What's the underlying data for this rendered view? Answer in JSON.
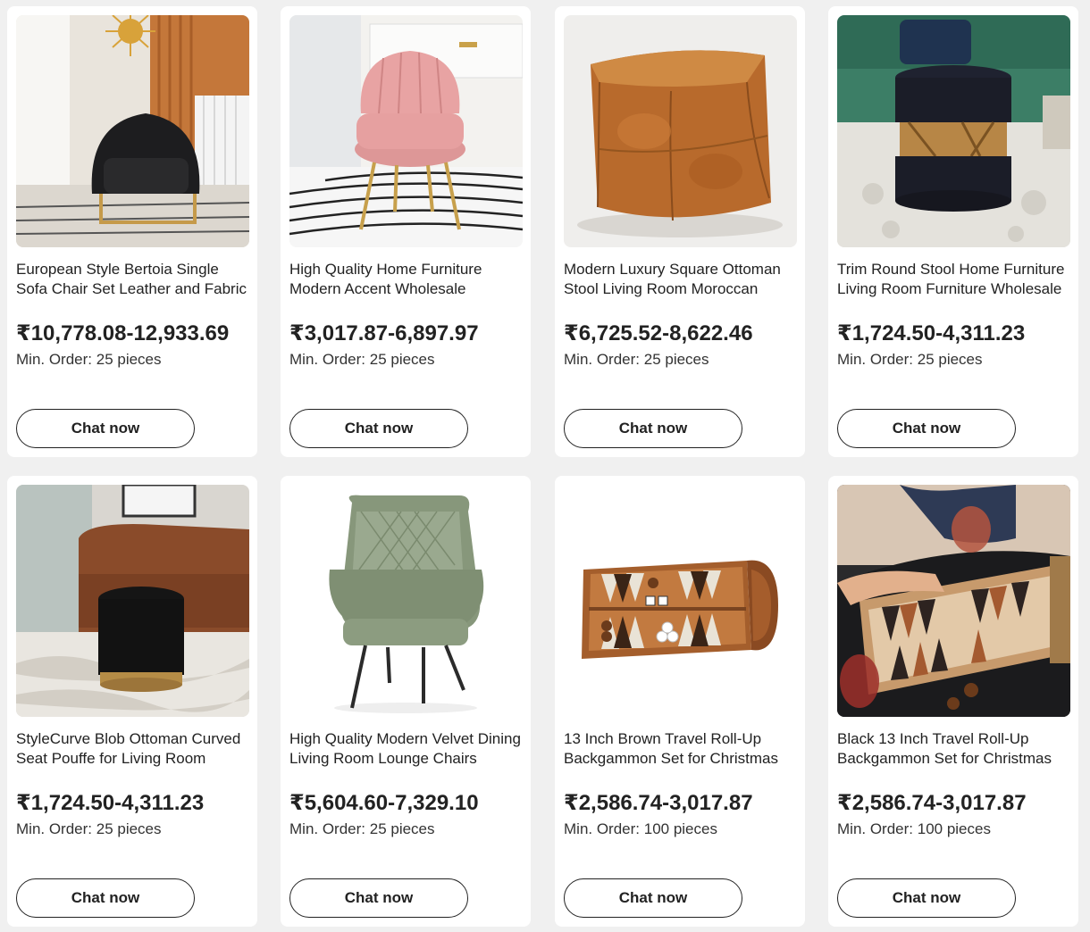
{
  "chat_label": "Chat now",
  "products": [
    {
      "title": "European Style Bertoia Single Sofa Chair Set Leather and Fabric",
      "price": "₹10,778.08-12,933.69",
      "moq": "Min. Order: 25 pieces",
      "image": "black-velvet-armchair"
    },
    {
      "title": "High Quality Home Furniture Modern Accent Wholesale",
      "price": "₹3,017.87-6,897.97",
      "moq": "Min. Order: 25 pieces",
      "image": "pink-velvet-chair"
    },
    {
      "title": "Modern Luxury Square Ottoman Stool Living Room Moroccan",
      "price": "₹6,725.52-8,622.46",
      "moq": "Min. Order: 25 pieces",
      "image": "leather-square-pouf"
    },
    {
      "title": "Trim Round Stool Home Furniture Living Room Furniture Wholesale",
      "price": "₹1,724.50-4,311.23",
      "moq": "Min. Order: 25 pieces",
      "image": "black-round-stool"
    },
    {
      "title": "StyleCurve Blob Ottoman Curved Seat Pouffe for Living Room",
      "price": "₹1,724.50-4,311.23",
      "moq": "Min. Order: 25 pieces",
      "image": "black-velvet-pouffe"
    },
    {
      "title": "High Quality Modern Velvet Dining Living Room Lounge Chairs",
      "price": "₹5,604.60-7,329.10",
      "moq": "Min. Order: 25 pieces",
      "image": "green-dining-chair"
    },
    {
      "title": "13 Inch Brown Travel Roll-Up Backgammon Set for Christmas",
      "price": "₹2,586.74-3,017.87",
      "moq": "Min. Order: 100 pieces",
      "image": "brown-backgammon-roll"
    },
    {
      "title": "Black 13 Inch Travel Roll-Up Backgammon Set for Christmas",
      "price": "₹2,586.74-3,017.87",
      "moq": "Min. Order: 100 pieces",
      "image": "black-backgammon-roll"
    }
  ]
}
